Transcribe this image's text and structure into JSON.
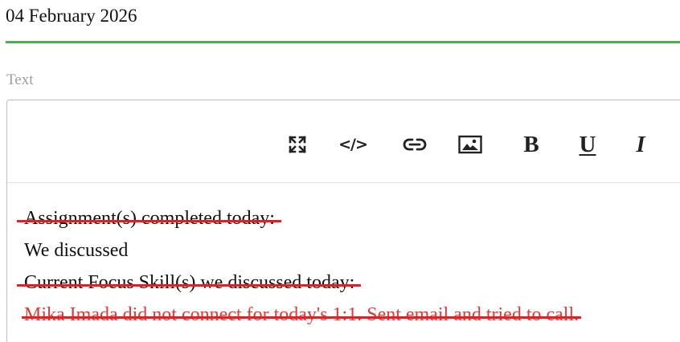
{
  "date_field": {
    "value": "04 February 2026",
    "underline_color": "#4caf50"
  },
  "text_field": {
    "label": "Text"
  },
  "toolbar": {
    "buttons": [
      {
        "name": "fullscreen",
        "icon": "fullscreen-expand-icon"
      },
      {
        "name": "code",
        "icon": "code-icon",
        "glyph": "</>"
      },
      {
        "name": "link",
        "icon": "link-icon"
      },
      {
        "name": "image",
        "icon": "image-icon"
      },
      {
        "name": "bold",
        "icon": "bold-icon",
        "glyph": "B"
      },
      {
        "name": "underline",
        "icon": "underline-icon",
        "glyph": "U"
      },
      {
        "name": "italic",
        "icon": "italic-icon",
        "glyph": "I"
      }
    ]
  },
  "editor_content": {
    "lines": [
      {
        "text": "Assignment(s) completed today:",
        "strikethrough": true,
        "color": "#111111"
      },
      {
        "text": "We discussed",
        "strikethrough": false,
        "color": "#111111"
      },
      {
        "text": "Current Focus Skill(s) we discussed today:",
        "strikethrough": true,
        "color": "#111111"
      },
      {
        "text": "Mika Imada did not connect for today's 1:1. Sent email and tried to call.",
        "strikethrough": true,
        "color": "#e53935"
      }
    ],
    "strike_color": "#e41f1f"
  }
}
